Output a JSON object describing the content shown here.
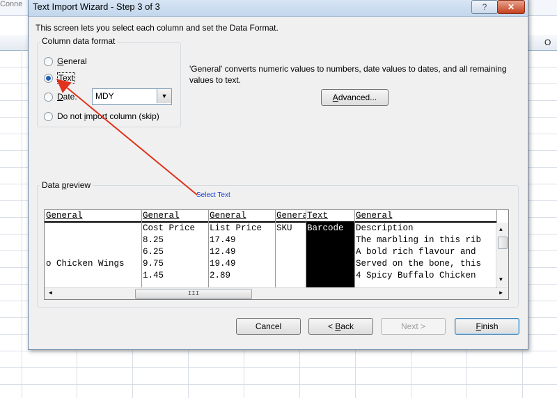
{
  "background": {
    "connection_label": "Conne",
    "column_header": "O"
  },
  "dialog": {
    "title": "Text Import Wizard - Step 3 of 3",
    "help_label": "?",
    "close_label": "✕",
    "instruction": "This screen lets you select each column and set the Data Format.",
    "column_format": {
      "legend": "Column data format",
      "options": [
        {
          "label": "General",
          "selected": false
        },
        {
          "label": "Text",
          "selected": true
        },
        {
          "label": "Date:",
          "selected": false
        },
        {
          "label": "Do not import column (skip)",
          "selected": false
        }
      ],
      "date_value": "MDY"
    },
    "explanation": "'General' converts numeric values to numbers, date values to dates, and all remaining values to text.",
    "advanced_label": "Advanced...",
    "preview": {
      "legend": "Data preview",
      "columns": [
        {
          "format": "General",
          "cells": [
            "",
            "",
            "",
            "o Chicken Wings"
          ]
        },
        {
          "format": "General",
          "cells": [
            "Cost Price",
            "8.25",
            "6.25",
            "9.75",
            "1.45"
          ]
        },
        {
          "format": "General",
          "cells": [
            "List Price",
            "17.49",
            "12.49",
            "19.49",
            "2.89"
          ]
        },
        {
          "format": "General",
          "cells": [
            "SKU",
            "",
            "",
            "",
            ""
          ]
        },
        {
          "format": "Text",
          "cells": [
            "Barcode",
            "",
            "",
            "",
            ""
          ]
        },
        {
          "format": "General",
          "cells": [
            "Description",
            "The marbling in this rib",
            "A bold rich flavour and",
            "Served on the bone, this",
            "4 Spicy Buffalo Chicken"
          ]
        }
      ],
      "scroll_thumb_label": "III"
    },
    "annotation": "Select Text",
    "buttons": {
      "cancel": "Cancel",
      "back": "< Back",
      "next": "Next >",
      "finish": "Finish"
    }
  },
  "colors": {
    "annotation_text": "#1a3fd0",
    "arrow": "#e0321e",
    "selected_column": "#000000"
  }
}
